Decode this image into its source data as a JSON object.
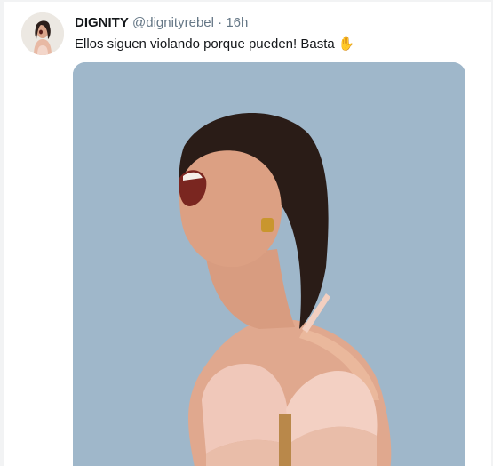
{
  "tweet": {
    "display_name": "DIGNITY",
    "handle": "@dignityrebel",
    "separator": "·",
    "time": "16h",
    "text": "Ellos siguen violando porque pueden! Basta",
    "emoji": "✋"
  },
  "media": {
    "description_icon": "photo",
    "background_color": "#9fb7ca"
  }
}
